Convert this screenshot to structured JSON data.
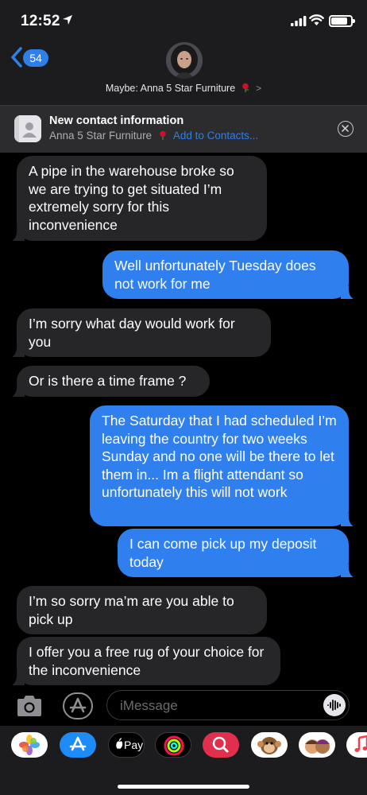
{
  "status_bar": {
    "time": "12:52"
  },
  "header": {
    "back_count": "54",
    "contact_name": "Maybe: Anna 5 Star Furniture",
    "chevron": ">"
  },
  "banner": {
    "title": "New contact information",
    "subtitle": "Anna 5 Star Furniture",
    "action": "Add to Contacts..."
  },
  "messages": [
    {
      "direction": "incoming",
      "text": "A pipe in the warehouse broke so we are trying to get situated I’m extremely sorry for this inconvenience"
    },
    {
      "direction": "outgoing",
      "text": "Well unfortunately Tuesday does not work for me"
    },
    {
      "direction": "incoming",
      "text": "I’m sorry what day would work for you"
    },
    {
      "direction": "incoming",
      "text": "Or is there a time frame ?"
    },
    {
      "direction": "outgoing",
      "text": "The Saturday that I had scheduled I’m leaving the country for two weeks Sunday and no one will be there to let them in... Im a flight attendant so unfortunately this will not work"
    },
    {
      "direction": "outgoing",
      "text": "I can come pick up my deposit today"
    },
    {
      "direction": "incoming",
      "text": "I’m so sorry ma’m are you able to pick up"
    },
    {
      "direction": "incoming",
      "text": "I offer you a free rug of your choice for the inconvenience"
    }
  ],
  "input": {
    "placeholder": "iMessage"
  },
  "app_drawer": {
    "apps": [
      {
        "name": "photos-app",
        "icon": "photos-icon"
      },
      {
        "name": "app-store-app",
        "icon": "app-store-icon"
      },
      {
        "name": "apple-pay-app",
        "icon": "apple-pay-icon",
        "label": "Pay"
      },
      {
        "name": "activity-app",
        "icon": "activity-rings-icon"
      },
      {
        "name": "search-images-app",
        "icon": "image-search-icon"
      },
      {
        "name": "animoji-app",
        "icon": "monkey-animoji-icon"
      },
      {
        "name": "memoji-app",
        "icon": "memoji-stickers-icon"
      },
      {
        "name": "music-app",
        "icon": "music-icon"
      }
    ]
  },
  "colors": {
    "outgoing_bubble": "#2f80ee",
    "incoming_bubble": "#262629",
    "link": "#2f7fe8"
  }
}
